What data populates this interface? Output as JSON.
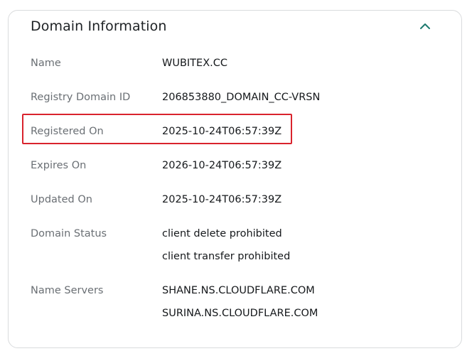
{
  "card": {
    "title": "Domain Information",
    "collapse_icon": "chevron-up-icon",
    "accent_color": "#1e7a6f"
  },
  "highlight": {
    "color": "#d9232d",
    "target_row": "Registered On"
  },
  "rows": [
    {
      "label": "Name",
      "values": [
        "WUBITEX.CC"
      ]
    },
    {
      "label": "Registry Domain ID",
      "values": [
        "206853880_DOMAIN_CC-VRSN"
      ]
    },
    {
      "label": "Registered On",
      "values": [
        "2025-10-24T06:57:39Z"
      ]
    },
    {
      "label": "Expires On",
      "values": [
        "2026-10-24T06:57:39Z"
      ]
    },
    {
      "label": "Updated On",
      "values": [
        "2025-10-24T06:57:39Z"
      ]
    },
    {
      "label": "Domain Status",
      "values": [
        "client delete prohibited",
        "client transfer prohibited"
      ]
    },
    {
      "label": "Name Servers",
      "values": [
        "SHANE.NS.CLOUDFLARE.COM",
        "SURINA.NS.CLOUDFLARE.COM"
      ]
    }
  ]
}
